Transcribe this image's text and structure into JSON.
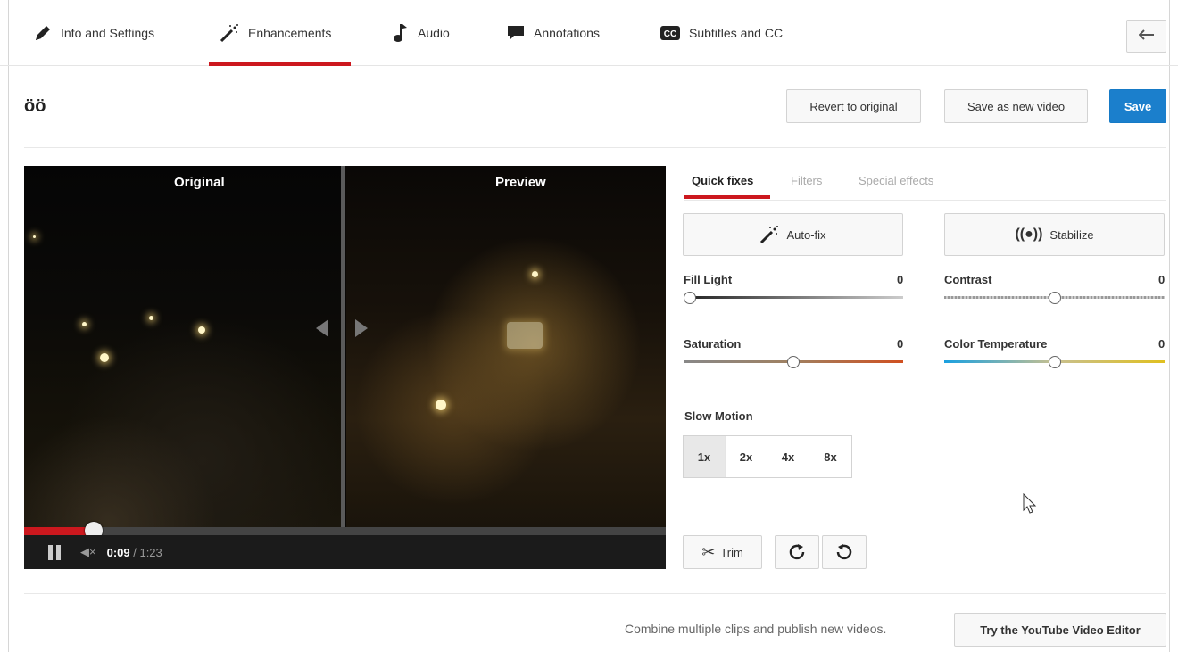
{
  "nav": {
    "tabs": [
      {
        "label": "Info and Settings",
        "icon": "pencil-icon"
      },
      {
        "label": "Enhancements",
        "icon": "magic-wand-icon"
      },
      {
        "label": "Audio",
        "icon": "music-note-icon"
      },
      {
        "label": "Annotations",
        "icon": "speech-bubble-icon"
      },
      {
        "label": "Subtitles and CC",
        "icon": "cc-icon"
      }
    ],
    "active_tab": "Enhancements",
    "back_icon": "back-arrow-icon"
  },
  "header": {
    "title": "öö",
    "revert_label": "Revert to original",
    "save_new_label": "Save as new video",
    "save_label": "Save"
  },
  "video": {
    "left_label": "Original",
    "right_label": "Preview",
    "progress_fraction": 0.108,
    "current_time": "0:09",
    "separator": " / ",
    "duration": "1:23",
    "mute_glyph": "◀×"
  },
  "panel": {
    "subtabs": [
      "Quick fixes",
      "Filters",
      "Special effects"
    ],
    "active_subtab": "Quick fixes",
    "autofix_label": "Auto-fix",
    "stabilize_label": "Stabilize",
    "sliders": {
      "fill_light": {
        "label": "Fill Light",
        "value": "0",
        "level": 0.0
      },
      "contrast": {
        "label": "Contrast",
        "value": "0",
        "level": 0.5
      },
      "saturation": {
        "label": "Saturation",
        "value": "0",
        "level": 0.5
      },
      "color_temperature": {
        "label": "Color Temperature",
        "value": "0",
        "level": 0.5
      }
    },
    "slow_motion": {
      "label": "Slow Motion",
      "options": [
        "1x",
        "2x",
        "4x",
        "8x"
      ],
      "selected": "1x"
    },
    "trim_label": "Trim",
    "rotate_right_icon": "rotate-clockwise-icon",
    "rotate_left_icon": "rotate-counterclockwise-icon"
  },
  "footer": {
    "text": "Combine multiple clips and publish new videos.",
    "button_label": "Try the YouTube Video Editor"
  },
  "colors": {
    "accent_red": "#cc181e",
    "save_blue": "#1b7fcc"
  }
}
